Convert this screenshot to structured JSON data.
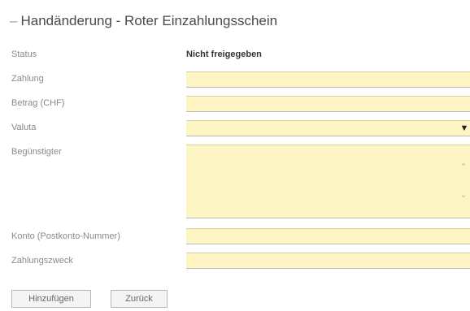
{
  "form": {
    "title": "Handänderung - Roter Einzahlungsschein",
    "title_bullet": "–",
    "status_label": "Status",
    "status_value": "Nicht freigegeben",
    "zahlung_label": "Zahlung",
    "betrag_label": "Betrag (CHF)",
    "valuta_label": "Valuta",
    "beguenstigter_label": "Begünstigter",
    "konto_label": "Konto (Postkonto-Nummer)",
    "zahlungszweck_label": "Zahlungszweck",
    "select_icon": "chevron-down-icon"
  },
  "buttons": {
    "hinzufuegen": "Hinzufügen",
    "zurueck": "Zurück"
  },
  "colors": {
    "field_bg": "#fdf6c4"
  }
}
